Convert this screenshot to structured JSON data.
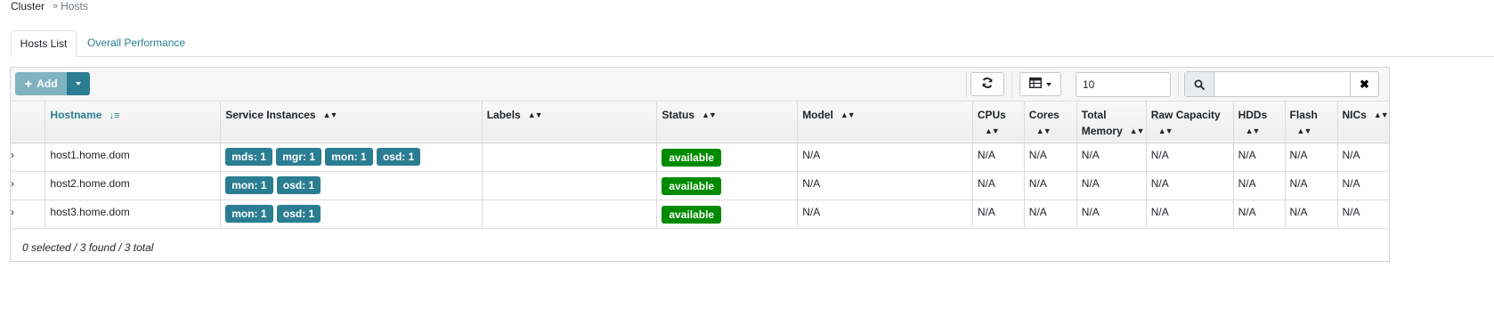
{
  "breadcrumb": {
    "root": "Cluster",
    "separator": "»",
    "current": "Hosts"
  },
  "tabs": [
    {
      "label": "Hosts List",
      "active": true
    },
    {
      "label": "Overall Performance",
      "active": false
    }
  ],
  "toolbar": {
    "add_label": "Add",
    "add_icon": "plus-icon",
    "refresh_icon": "refresh-icon",
    "columns_icon": "table-icon",
    "page_size": "10",
    "search_value": "",
    "search_icon": "search-icon",
    "clear_icon": "close-icon"
  },
  "table": {
    "columns": [
      {
        "label": "Hostname",
        "sort": "asc"
      },
      {
        "label": "Service Instances",
        "sort": "both"
      },
      {
        "label": "Labels",
        "sort": "both"
      },
      {
        "label": "Status",
        "sort": "both"
      },
      {
        "label": "Model",
        "sort": "both"
      },
      {
        "label": "CPUs",
        "sort": "both"
      },
      {
        "label": "Cores",
        "sort": "both"
      },
      {
        "label": "Total Memory",
        "sort": "both"
      },
      {
        "label": "Raw Capacity",
        "sort": "both"
      },
      {
        "label": "HDDs",
        "sort": "both"
      },
      {
        "label": "Flash",
        "sort": "both"
      },
      {
        "label": "NICs",
        "sort": "both"
      }
    ],
    "rows": [
      {
        "hostname": "host1.home.dom",
        "services": [
          "mds: 1",
          "mgr: 1",
          "mon: 1",
          "osd: 1"
        ],
        "labels": "",
        "status": "available",
        "model": "N/A",
        "cpus": "N/A",
        "cores": "N/A",
        "memory": "N/A",
        "raw_capacity": "N/A",
        "hdds": "N/A",
        "flash": "N/A",
        "nics": "N/A"
      },
      {
        "hostname": "host2.home.dom",
        "services": [
          "mon: 1",
          "osd: 1"
        ],
        "labels": "",
        "status": "available",
        "model": "N/A",
        "cpus": "N/A",
        "cores": "N/A",
        "memory": "N/A",
        "raw_capacity": "N/A",
        "hdds": "N/A",
        "flash": "N/A",
        "nics": "N/A"
      },
      {
        "hostname": "host3.home.dom",
        "services": [
          "mon: 1",
          "osd: 1"
        ],
        "labels": "",
        "status": "available",
        "model": "N/A",
        "cpus": "N/A",
        "cores": "N/A",
        "memory": "N/A",
        "raw_capacity": "N/A",
        "hdds": "N/A",
        "flash": "N/A",
        "nics": "N/A"
      }
    ],
    "footer": "0 selected / 3 found / 3 total"
  },
  "colors": {
    "accent": "#2b7d92",
    "status_available": "#008a00",
    "add_disabled": "#7fb3bf"
  }
}
